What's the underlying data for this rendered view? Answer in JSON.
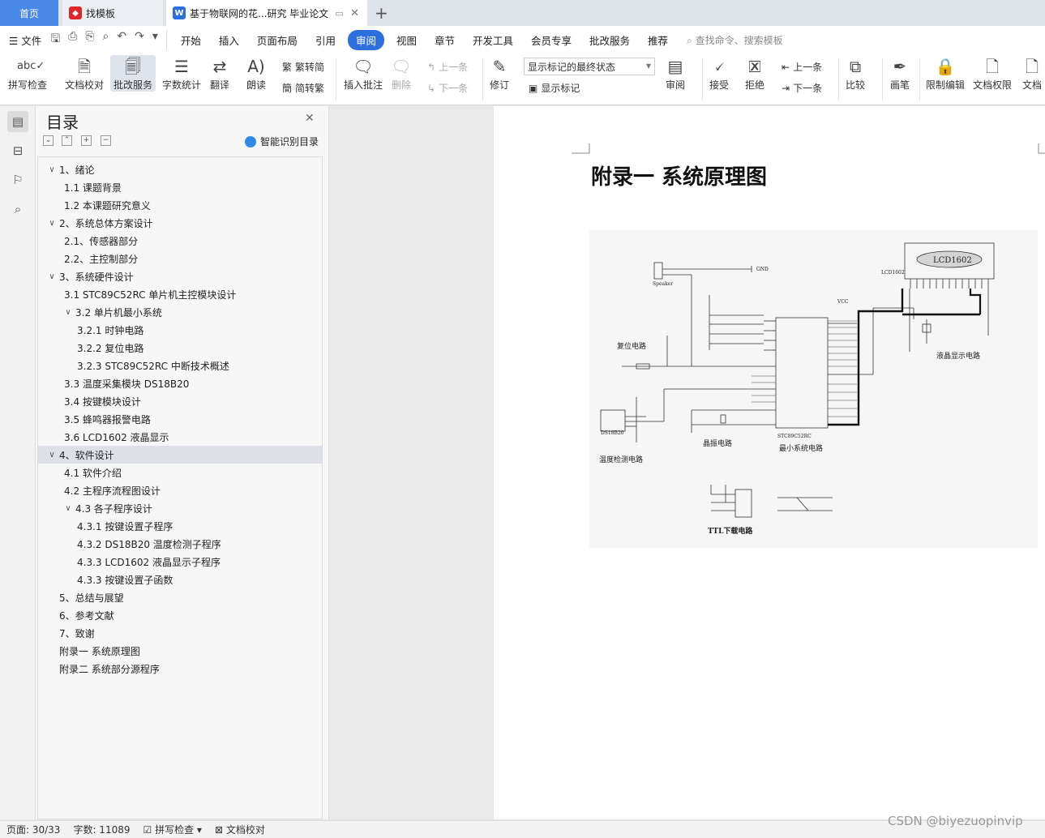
{
  "tabs": {
    "home": "首页",
    "template": "找模板",
    "document": "基于物联网的花...研究 毕业论文"
  },
  "menu": {
    "file": "文件",
    "items": [
      "开始",
      "插入",
      "页面布局",
      "引用",
      "审阅",
      "视图",
      "章节",
      "开发工具",
      "会员专享",
      "批改服务",
      "推荐"
    ],
    "active": "审阅",
    "search_placeholder": "查找命令、搜索模板"
  },
  "ribbon": {
    "spellcheck": "拼写检查",
    "doc_check": "文档校对",
    "review_service": "批改服务",
    "word_count": "字数统计",
    "translate": "翻译",
    "read_aloud": "朗读",
    "trad_simp": "繁转简",
    "simp_trad": "简转繁",
    "insert_comment": "插入批注",
    "delete": "删除",
    "prev_comment": "上一条",
    "next_comment": "下一条",
    "revise": "修订",
    "markup_state": "显示标记的最终状态",
    "show_markup": "显示标记",
    "review": "审阅",
    "accept": "接受",
    "reject": "拒绝",
    "prev": "上一条",
    "next": "下一条",
    "compare": "比较",
    "pen": "画笔",
    "restrict_edit": "限制编辑",
    "doc_permission": "文档权限",
    "doc_more": "文档"
  },
  "toc": {
    "title": "目录",
    "smart_label": "智能识别目录",
    "items": [
      {
        "label": "1、绪论",
        "level": 1,
        "chevron": true
      },
      {
        "label": "1.1 课题背景",
        "level": 2,
        "chevron": false
      },
      {
        "label": "1.2  本课题研究意义",
        "level": 2,
        "chevron": false
      },
      {
        "label": "2、系统总体方案设计",
        "level": 1,
        "chevron": true
      },
      {
        "label": "2.1、传感器部分",
        "level": 2,
        "chevron": false
      },
      {
        "label": "2.2、主控制部分",
        "level": 2,
        "chevron": false
      },
      {
        "label": "3、系统硬件设计",
        "level": 1,
        "chevron": true
      },
      {
        "label": "3.1 STC89C52RC 单片机主控模块设计",
        "level": 2,
        "chevron": false
      },
      {
        "label": "3.2 单片机最小系统",
        "level": 2,
        "chevron": true
      },
      {
        "label": "3.2.1 时钟电路",
        "level": 3,
        "chevron": false
      },
      {
        "label": "3.2.2 复位电路",
        "level": 3,
        "chevron": false
      },
      {
        "label": "3.2.3 STC89C52RC 中断技术概述",
        "level": 3,
        "chevron": false
      },
      {
        "label": "3.3  温度采集模块 DS18B20",
        "level": 2,
        "chevron": false
      },
      {
        "label": "3.4 按键模块设计",
        "level": 2,
        "chevron": false
      },
      {
        "label": "3.5 蜂鸣器报警电路",
        "level": 2,
        "chevron": false
      },
      {
        "label": "3.6 LCD1602 液晶显示",
        "level": 2,
        "chevron": false
      },
      {
        "label": "4、软件设计",
        "level": 1,
        "chevron": true,
        "selected": true
      },
      {
        "label": "4.1 软件介绍",
        "level": 2,
        "chevron": false
      },
      {
        "label": "4.2  主程序流程图设计",
        "level": 2,
        "chevron": false
      },
      {
        "label": "4.3 各子程序设计",
        "level": 2,
        "chevron": true
      },
      {
        "label": "4.3.1 按键设置子程序",
        "level": 3,
        "chevron": false
      },
      {
        "label": "4.3.2 DS18B20 温度检测子程序",
        "level": 3,
        "chevron": false
      },
      {
        "label": "4.3.3 LCD1602 液晶显示子程序",
        "level": 3,
        "chevron": false
      },
      {
        "label": "4.3.3  按键设置子函数",
        "level": 3,
        "chevron": false
      },
      {
        "label": "5、总结与展望",
        "level": 1,
        "chevron": false
      },
      {
        "label": "6、参考文献",
        "level": 1,
        "chevron": false
      },
      {
        "label": "7、致谢",
        "level": 1,
        "chevron": false
      },
      {
        "label": "附录一  系统原理图",
        "level": 1,
        "chevron": false
      },
      {
        "label": "附录二  系统部分源程序",
        "level": 1,
        "chevron": false
      }
    ]
  },
  "document": {
    "heading": "附录一  系统原理图",
    "schematic": {
      "lcd": "LCD1602",
      "lcd_label": "LCD1602",
      "mcu": "STC89C52RC",
      "reset": "复位电路",
      "lcd_circuit": "液晶显示电路",
      "temp_circuit": "温度检测电路",
      "crystal": "晶振电路",
      "min_system": "最小系统电路",
      "ttl": "TTL下载电路",
      "speaker": "Speaker",
      "gnd": "GND",
      "vcc": "VCC",
      "ds18b20": "DS18B20"
    }
  },
  "status": {
    "page": "页面: 30/33",
    "words": "字数: 11089",
    "spell": "拼写检查",
    "proof": "文档校对"
  },
  "watermark": "CSDN @biyezuopinvip"
}
